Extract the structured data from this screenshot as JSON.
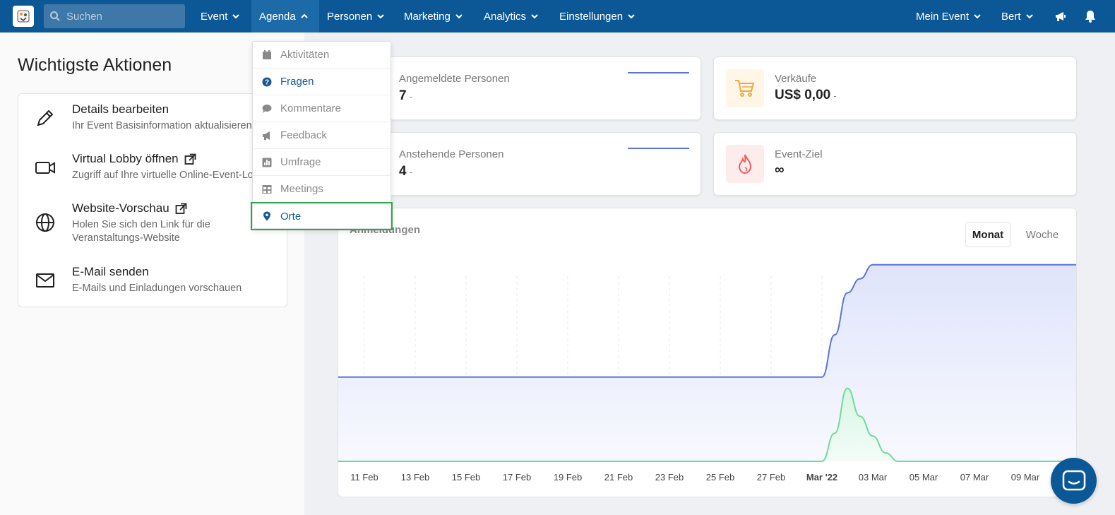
{
  "nav": {
    "search_placeholder": "Suchen",
    "items": [
      {
        "label": "Event"
      },
      {
        "label": "Agenda"
      },
      {
        "label": "Personen"
      },
      {
        "label": "Marketing"
      },
      {
        "label": "Analytics"
      },
      {
        "label": "Einstellungen"
      }
    ],
    "right_items": [
      {
        "label": "Mein Event"
      },
      {
        "label": "Bert"
      }
    ]
  },
  "dropdown": {
    "items": [
      {
        "label": "Aktivitäten",
        "icon": "calendar-icon"
      },
      {
        "label": "Fragen",
        "icon": "question-circle-icon"
      },
      {
        "label": "Kommentare",
        "icon": "comment-icon"
      },
      {
        "label": "Feedback",
        "icon": "megaphone-icon"
      },
      {
        "label": "Umfrage",
        "icon": "poll-icon"
      },
      {
        "label": "Meetings",
        "icon": "table-icon"
      },
      {
        "label": "Orte",
        "icon": "map-pin-icon"
      }
    ]
  },
  "left": {
    "title": "Wichtigste Aktionen",
    "actions": [
      {
        "title": "Details bearbeiten",
        "desc": "Ihr Event Basisinformation aktualisieren",
        "icon": "pencil-icon"
      },
      {
        "title": "Virtual Lobby öffnen",
        "desc": "Zugriff auf Ihre virtuelle Online-Event-Lobby",
        "icon": "video-camera-icon"
      },
      {
        "title": "Website-Vorschau",
        "desc": "Holen Sie sich den Link für die",
        "desc2": "Veranstaltungs-Website",
        "icon": "globe-icon"
      },
      {
        "title": "E-Mail senden",
        "desc": "E-Mails und Einladungen vorschauen",
        "icon": "envelope-icon"
      }
    ]
  },
  "stats": {
    "registered": {
      "label": "Angemeldete Personen",
      "value": "7",
      "suffix": "-"
    },
    "pending": {
      "label": "Anstehende Personen",
      "value": "4",
      "suffix": "-"
    },
    "sales": {
      "label": "Verkäufe",
      "value": "US$ 0,00",
      "suffix": "-"
    },
    "goal": {
      "label": "Event-Ziel",
      "value": "∞"
    }
  },
  "chart": {
    "title": "Anmeldungen",
    "toggle_month": "Monat",
    "toggle_week": "Woche"
  },
  "chart_data": {
    "type": "area",
    "title": "Anmeldungen",
    "categories": [
      "11 Feb",
      "13 Feb",
      "15 Feb",
      "17 Feb",
      "19 Feb",
      "21 Feb",
      "23 Feb",
      "25 Feb",
      "27 Feb",
      "Mar '22",
      "03 Mar",
      "05 Mar",
      "07 Mar",
      "09 Mar"
    ],
    "series": [
      {
        "color": "#5a73de",
        "x": [
          0,
          18,
          18.5,
          19,
          19.5,
          20,
          20.5,
          21,
          29
        ],
        "values": [
          3,
          3,
          4.5,
          6,
          6.5,
          7,
          7,
          7,
          7
        ]
      },
      {
        "color": "#6fdc9a",
        "x": [
          0,
          18,
          18.5,
          19,
          19.5,
          20,
          20.5,
          21,
          29
        ],
        "values": [
          0,
          0,
          1,
          2.6,
          1.6,
          0.9,
          0.3,
          0,
          0
        ]
      }
    ],
    "ylim": [
      0,
      8
    ],
    "grid": "vertical dashed"
  }
}
